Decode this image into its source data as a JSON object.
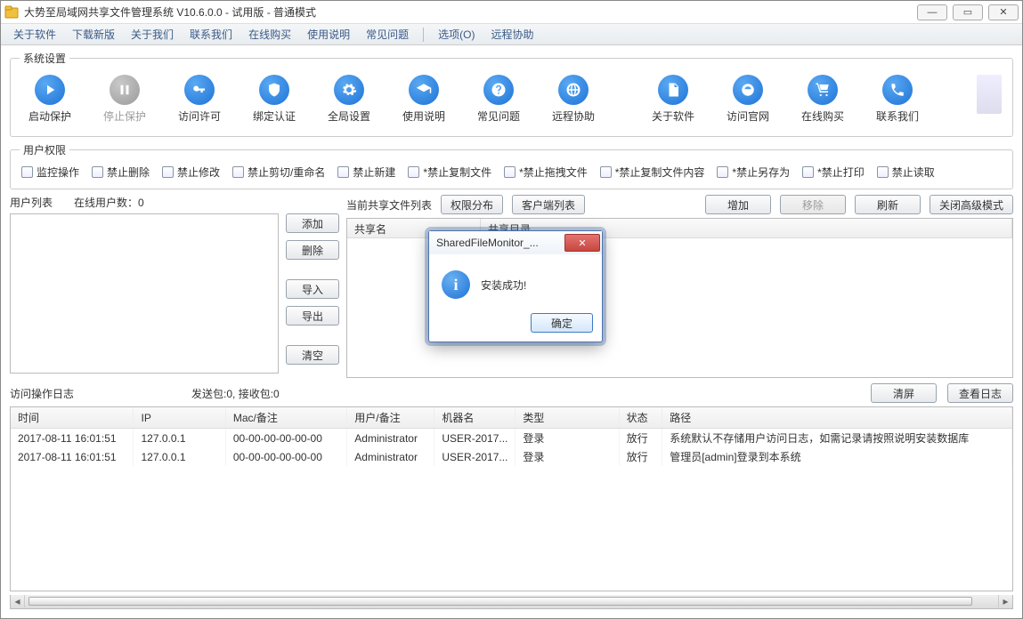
{
  "title": "大势至局域网共享文件管理系统 V10.6.0.0 - 试用版 - 普通模式",
  "menu": [
    "关于软件",
    "下载新版",
    "关于我们",
    "联系我们",
    "在线购买",
    "使用说明",
    "常见问题",
    "选项(O)",
    "远程协助"
  ],
  "groups": {
    "system_settings": "系统设置",
    "user_permissions": "用户权限"
  },
  "toolbar": [
    {
      "id": "start-protect",
      "label": "启动保护",
      "icon": "play",
      "enabled": true
    },
    {
      "id": "stop-protect",
      "label": "停止保护",
      "icon": "pause",
      "enabled": false
    },
    {
      "id": "access-permit",
      "label": "访问许可",
      "icon": "key",
      "enabled": true
    },
    {
      "id": "bind-auth",
      "label": "绑定认证",
      "icon": "shield",
      "enabled": true
    },
    {
      "id": "global-settings",
      "label": "全局设置",
      "icon": "gear",
      "enabled": true
    },
    {
      "id": "usage-guide",
      "label": "使用说明",
      "icon": "grad",
      "enabled": true
    },
    {
      "id": "faq",
      "label": "常见问题",
      "icon": "question",
      "enabled": true
    },
    {
      "id": "remote-assist",
      "label": "远程协助",
      "icon": "globe",
      "enabled": true
    },
    {
      "id": "about-software",
      "label": "关于软件",
      "icon": "doc",
      "enabled": true
    },
    {
      "id": "visit-site",
      "label": "访问官网",
      "icon": "ie",
      "enabled": true
    },
    {
      "id": "buy-online",
      "label": "在线购买",
      "icon": "cart",
      "enabled": true
    },
    {
      "id": "contact-us",
      "label": "联系我们",
      "icon": "phone",
      "enabled": true
    }
  ],
  "permissions": [
    "监控操作",
    "禁止删除",
    "禁止修改",
    "禁止剪切/重命名",
    "禁止新建",
    "*禁止复制文件",
    "*禁止拖拽文件",
    "*禁止复制文件内容",
    "*禁止另存为",
    "*禁止打印",
    "禁止读取"
  ],
  "userlist": {
    "label": "用户列表",
    "online_label": "在线用户数：",
    "online_count": "0",
    "buttons": {
      "add": "添加",
      "delete": "删除",
      "import": "导入",
      "export": "导出",
      "clear": "清空"
    }
  },
  "sharelist": {
    "label": "当前共享文件列表",
    "cols": {
      "name": "共享名",
      "dir": "共享目录"
    },
    "buttons": {
      "perm": "权限分布",
      "client": "客户端列表",
      "add": "增加",
      "remove": "移除",
      "refresh": "刷新",
      "close_adv": "关闭高级模式"
    },
    "remove_enabled": false
  },
  "log": {
    "title": "访问操作日志",
    "stats": "发送包:0, 接收包:0",
    "buttons": {
      "clear": "清屏",
      "view": "查看日志"
    },
    "columns": [
      "时间",
      "IP",
      "Mac/备注",
      "用户/备注",
      "机器名",
      "类型",
      "状态",
      "路径"
    ],
    "rows": [
      {
        "time": "2017-08-11 16:01:51",
        "ip": "127.0.0.1",
        "mac": "00-00-00-00-00-00",
        "user": "Administrator",
        "machine": "USER-2017...",
        "type": "登录",
        "status": "放行",
        "path": "系统默认不存储用户访问日志，如需记录请按照说明安装数据库"
      },
      {
        "time": "2017-08-11 16:01:51",
        "ip": "127.0.0.1",
        "mac": "00-00-00-00-00-00",
        "user": "Administrator",
        "machine": "USER-2017...",
        "type": "登录",
        "status": "放行",
        "path": "管理员[admin]登录到本系统"
      }
    ]
  },
  "modal": {
    "title": "SharedFileMonitor_...",
    "message": "安装成功!",
    "ok": "确定"
  }
}
